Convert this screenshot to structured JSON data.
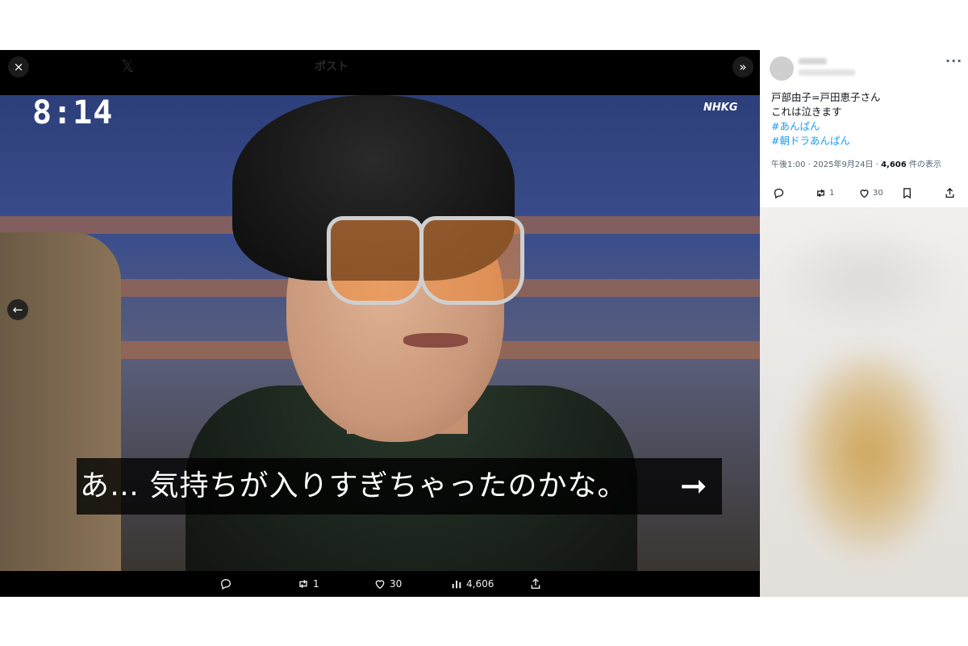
{
  "viewer": {
    "close_label": "×",
    "expand_label": "»",
    "prev_label": "←",
    "background": {
      "x_logo": "𝕏",
      "page_title": "ポスト"
    },
    "video": {
      "clock": "8:14",
      "channel_logo": "NHKG",
      "subtitle": "あ… 気持ちが入りすぎちゃったのかな。",
      "subtitle_arrow": "➞"
    },
    "actions": {
      "reply_icon": "reply-icon",
      "repost_icon": "repost-icon",
      "repost_count": "1",
      "like_icon": "heart-icon",
      "like_count": "30",
      "views_icon": "views-icon",
      "views_count": "4,606",
      "share_icon": "share-icon"
    }
  },
  "tweet": {
    "more_label": "···",
    "lines": [
      "戸部由子=戸田恵子さん",
      "これは泣きます"
    ],
    "hashtags": [
      "#あんぱん",
      "#朝ドラあんぱん"
    ],
    "meta": {
      "time": "午後1:00 · 2025年9月24日 · ",
      "views": "4,606",
      "views_suffix": " 件の表示"
    },
    "actions": {
      "repost_count": "1",
      "like_count": "30"
    }
  },
  "colors": {
    "link": "#1d9bf0",
    "text": "#0f1419",
    "muted": "#536471",
    "viewer_bg": "#000000"
  }
}
